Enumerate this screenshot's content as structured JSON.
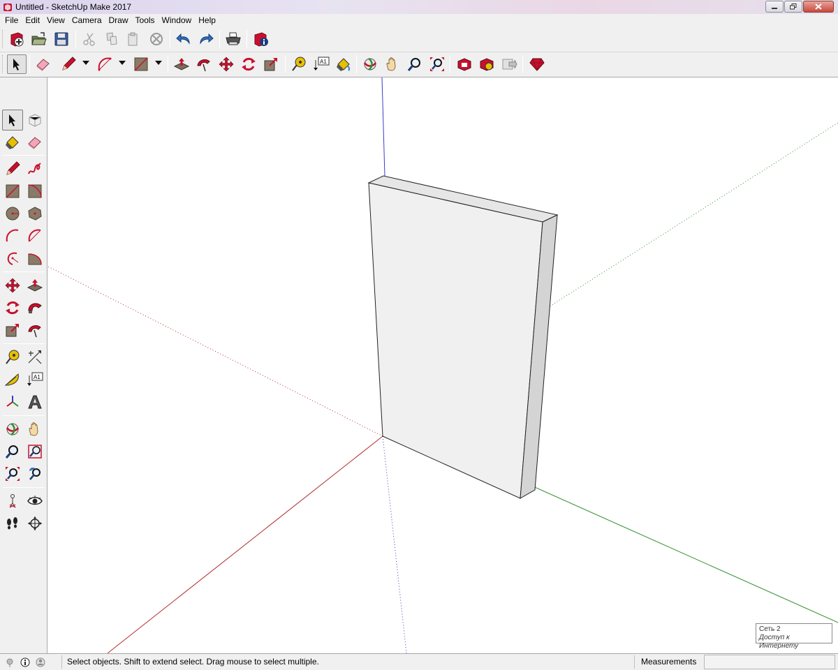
{
  "window": {
    "title": "Untitled - SketchUp Make 2017"
  },
  "menu": [
    "File",
    "Edit",
    "View",
    "Camera",
    "Draw",
    "Tools",
    "Window",
    "Help"
  ],
  "toolbar_top": {
    "icons": [
      "new-file-icon",
      "open-folder-icon",
      "save-icon",
      "cut-icon",
      "copy-icon",
      "paste-icon",
      "delete-icon",
      "undo-icon",
      "redo-icon",
      "print-icon",
      "model-info-icon"
    ]
  },
  "toolbar_main": {
    "icons": [
      "select-arrow-icon",
      "eraser-icon",
      "pencil-line-icon",
      "arc-icon",
      "rectangle-icon",
      "push-pull-icon",
      "follow-me-icon",
      "move-icon",
      "rotate-icon",
      "scale-icon",
      "tape-measure-icon",
      "text-label-icon",
      "paint-bucket-icon",
      "orbit-icon",
      "pan-hand-icon",
      "zoom-icon",
      "zoom-extents-icon",
      "3d-warehouse-icon",
      "extension-warehouse-icon",
      "layout-send-icon",
      "extension-ruby-icon"
    ],
    "text_label_glyph": "A1"
  },
  "left_toolbar": {
    "text_label_glyph": "A1"
  },
  "tooltip": {
    "network": "Сеть  2",
    "internet": "Доступ к Интернету"
  },
  "status": {
    "hint": "Select objects. Shift to extend select. Drag mouse to select multiple.",
    "measurements_label": "Measurements",
    "measurements_value": ""
  },
  "colors": {
    "accent_red": "#c8102e",
    "axis_red": "#b03030",
    "axis_green": "#2f8f2f",
    "axis_blue": "#3a3acc",
    "face": "#efefef"
  }
}
